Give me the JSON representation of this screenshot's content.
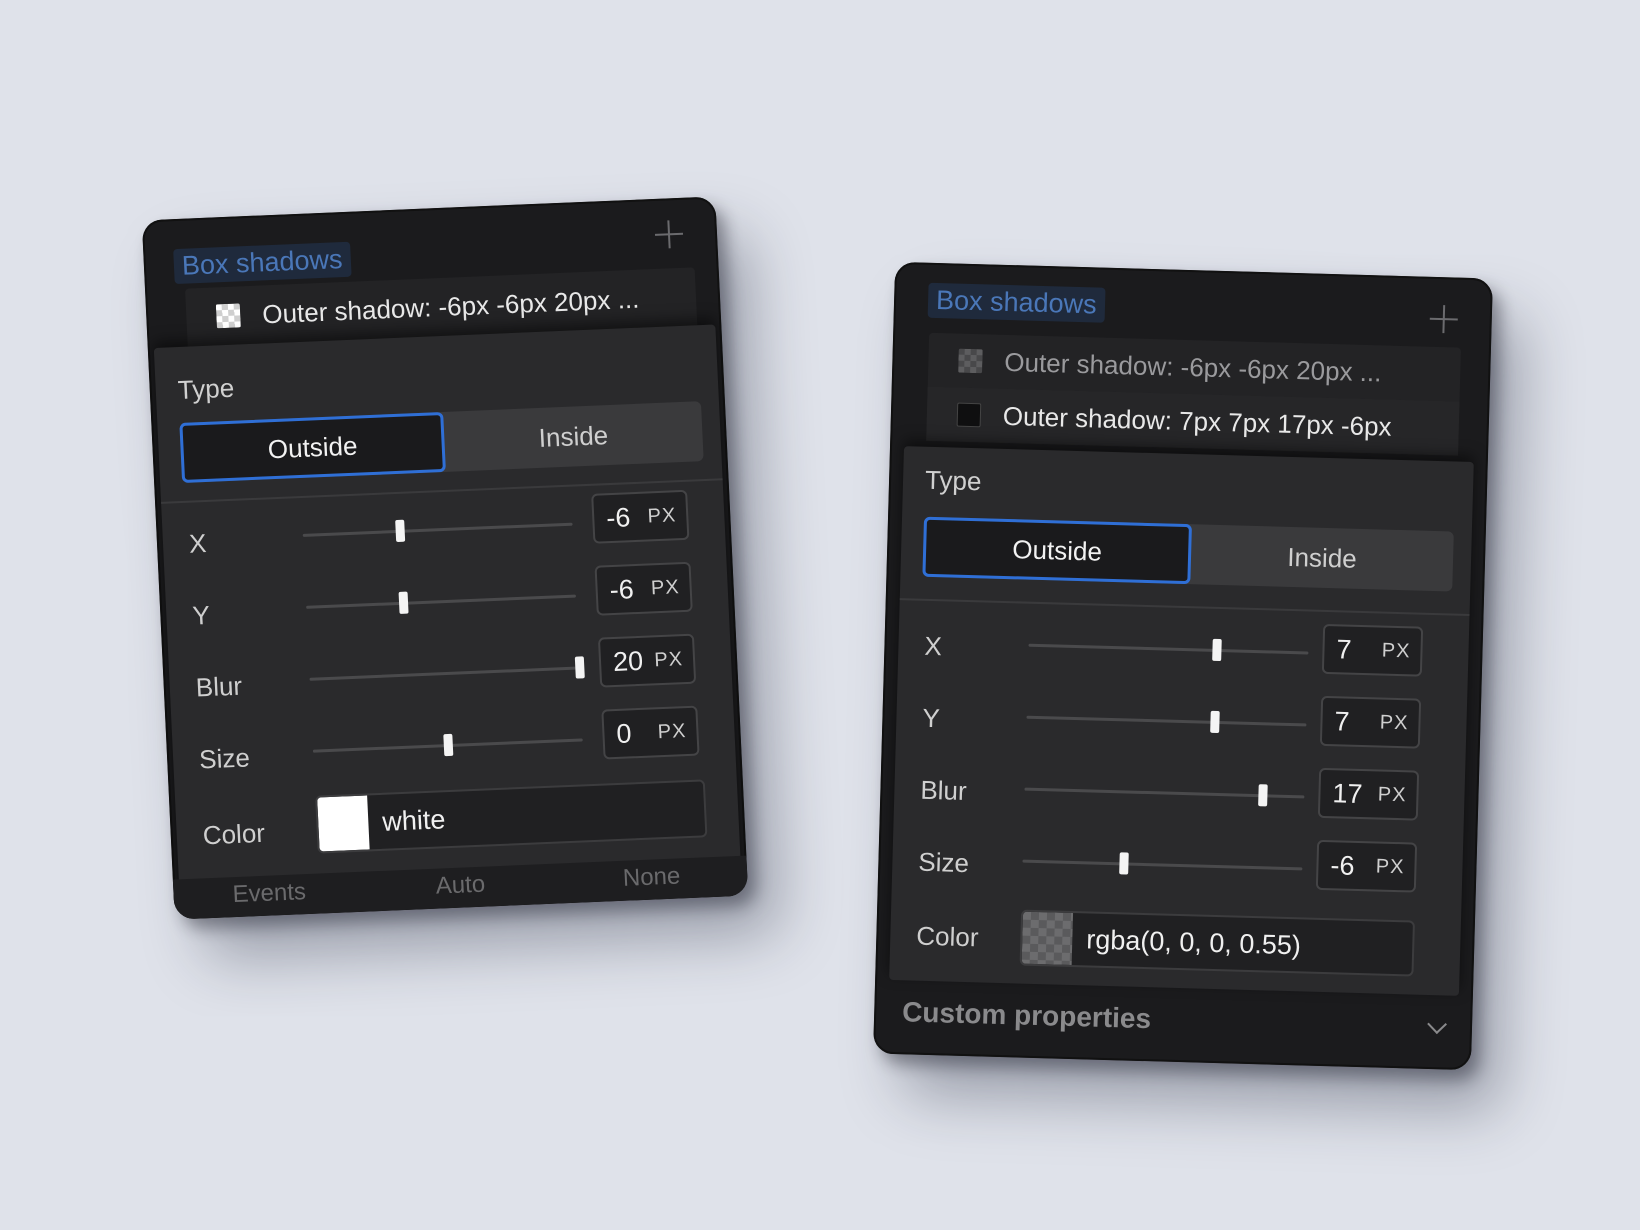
{
  "panels": [
    {
      "title": "Box shadows",
      "shadows": [
        {
          "label": "Outer shadow: -6px -6px 20px ..."
        }
      ],
      "type_label": "Type",
      "type_options": [
        "Outside",
        "Inside"
      ],
      "type_selected": "Outside",
      "fields": [
        {
          "label": "X",
          "value": "-6",
          "unit": "PX",
          "slider_fraction": 0.36
        },
        {
          "label": "Y",
          "value": "-6",
          "unit": "PX",
          "slider_fraction": 0.36
        },
        {
          "label": "Blur",
          "value": "20",
          "unit": "PX",
          "slider_fraction": 1.0
        },
        {
          "label": "Size",
          "value": "0",
          "unit": "PX",
          "slider_fraction": 0.5
        }
      ],
      "color_label": "Color",
      "color_value": "white",
      "footer": [
        "Events",
        "Auto",
        "None"
      ]
    },
    {
      "title": "Box shadows",
      "shadows": [
        {
          "label": "Outer shadow: -6px -6px 20px ..."
        },
        {
          "label": "Outer shadow: 7px 7px 17px -6px"
        }
      ],
      "type_label": "Type",
      "type_options": [
        "Outside",
        "Inside"
      ],
      "type_selected": "Outside",
      "fields": [
        {
          "label": "X",
          "value": "7",
          "unit": "PX",
          "slider_fraction": 0.67
        },
        {
          "label": "Y",
          "value": "7",
          "unit": "PX",
          "slider_fraction": 0.67
        },
        {
          "label": "Blur",
          "value": "17",
          "unit": "PX",
          "slider_fraction": 0.85
        },
        {
          "label": "Size",
          "value": "-6",
          "unit": "PX",
          "slider_fraction": 0.36
        }
      ],
      "color_label": "Color",
      "color_value": "rgba(0, 0, 0, 0.55)",
      "section_title": "Custom properties"
    }
  ],
  "colors": {
    "background": "#dfe2ea",
    "panel": "#1b1b1d",
    "accent": "#2f6fd6",
    "title": "#4a77b8"
  }
}
